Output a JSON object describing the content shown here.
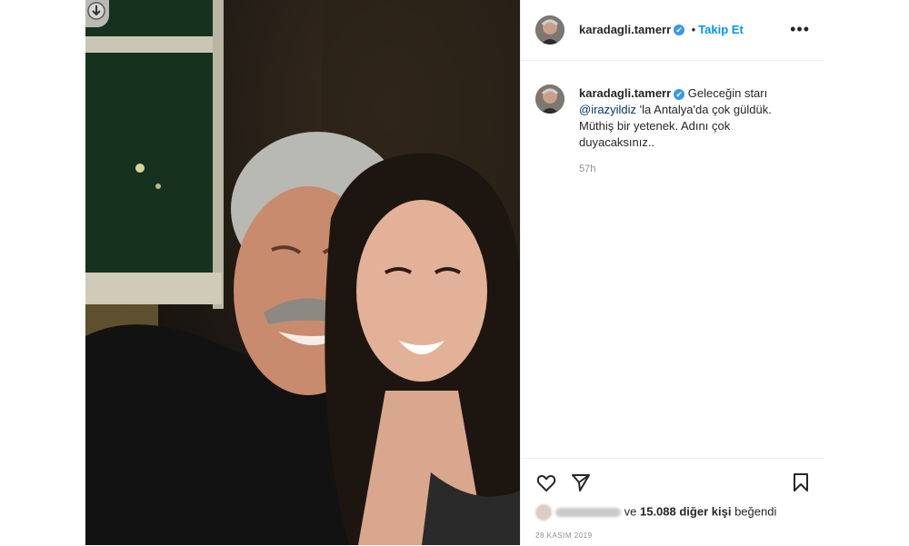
{
  "post": {
    "username": "karadagli.tamerr",
    "verified_badge": "✔",
    "follow_separator": "•",
    "follow_label": "Takip Et",
    "more_icon": "•••",
    "caption_before": "Geleceğin starı",
    "mention": "@irazyildiz",
    "caption_after": "'la Antalya'da çok güldük. Müthiş bir yetenek. Adını çok duyacaksınız..",
    "caption_time": "57h",
    "likes_connector": "ve",
    "likes_count": "15.088 diğer kişi",
    "likes_suffix": "beğendi",
    "date": "28 KASIM 2019"
  },
  "icons": {
    "like": "heart-icon",
    "share": "send-icon",
    "save": "bookmark-icon",
    "download": "download-icon"
  },
  "colors": {
    "follow_blue": "#0095f6",
    "verified_blue": "#3897f0",
    "muted_text": "#8e8e8e",
    "border": "#efefef"
  }
}
